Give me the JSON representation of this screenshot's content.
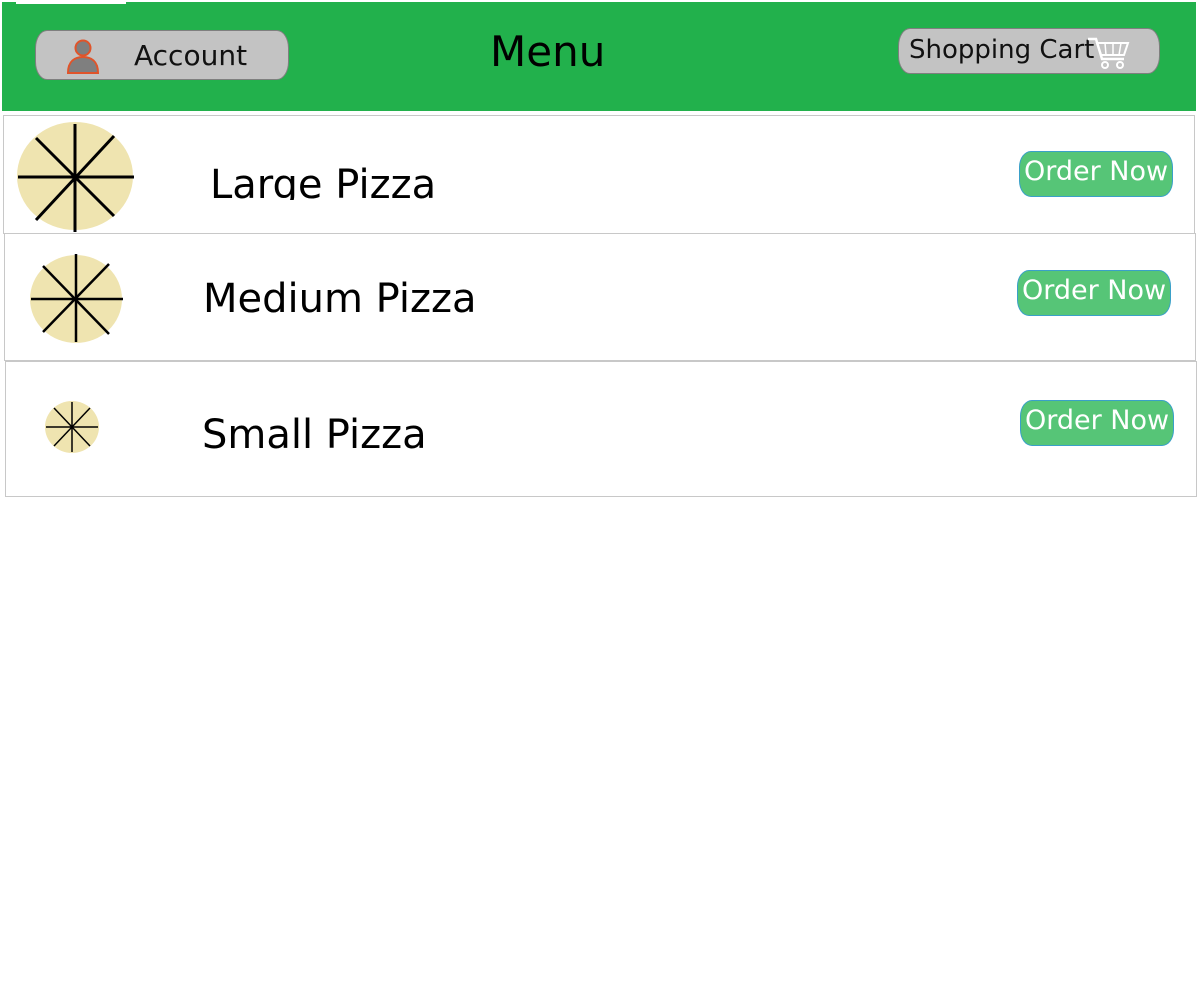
{
  "header": {
    "account_label": "Account",
    "title": "Menu",
    "cart_label": "Shopping Cart"
  },
  "menu": {
    "items": [
      {
        "name": "Large Pizza",
        "button_label": "Order Now"
      },
      {
        "name": "Medium Pizza",
        "button_label": "Order Now"
      },
      {
        "name": "Small Pizza",
        "button_label": "Order Now"
      }
    ]
  },
  "icons": {
    "account": "user-icon",
    "cart": "shopping-cart-icon",
    "pizza": "pizza-icon"
  },
  "colors": {
    "header_bg": "#22b14c",
    "header_button_bg": "#c3c3c3",
    "order_button_bg": "#56c577",
    "pizza_fill": "#efe4b0",
    "user_icon_outline": "#e0542a"
  }
}
